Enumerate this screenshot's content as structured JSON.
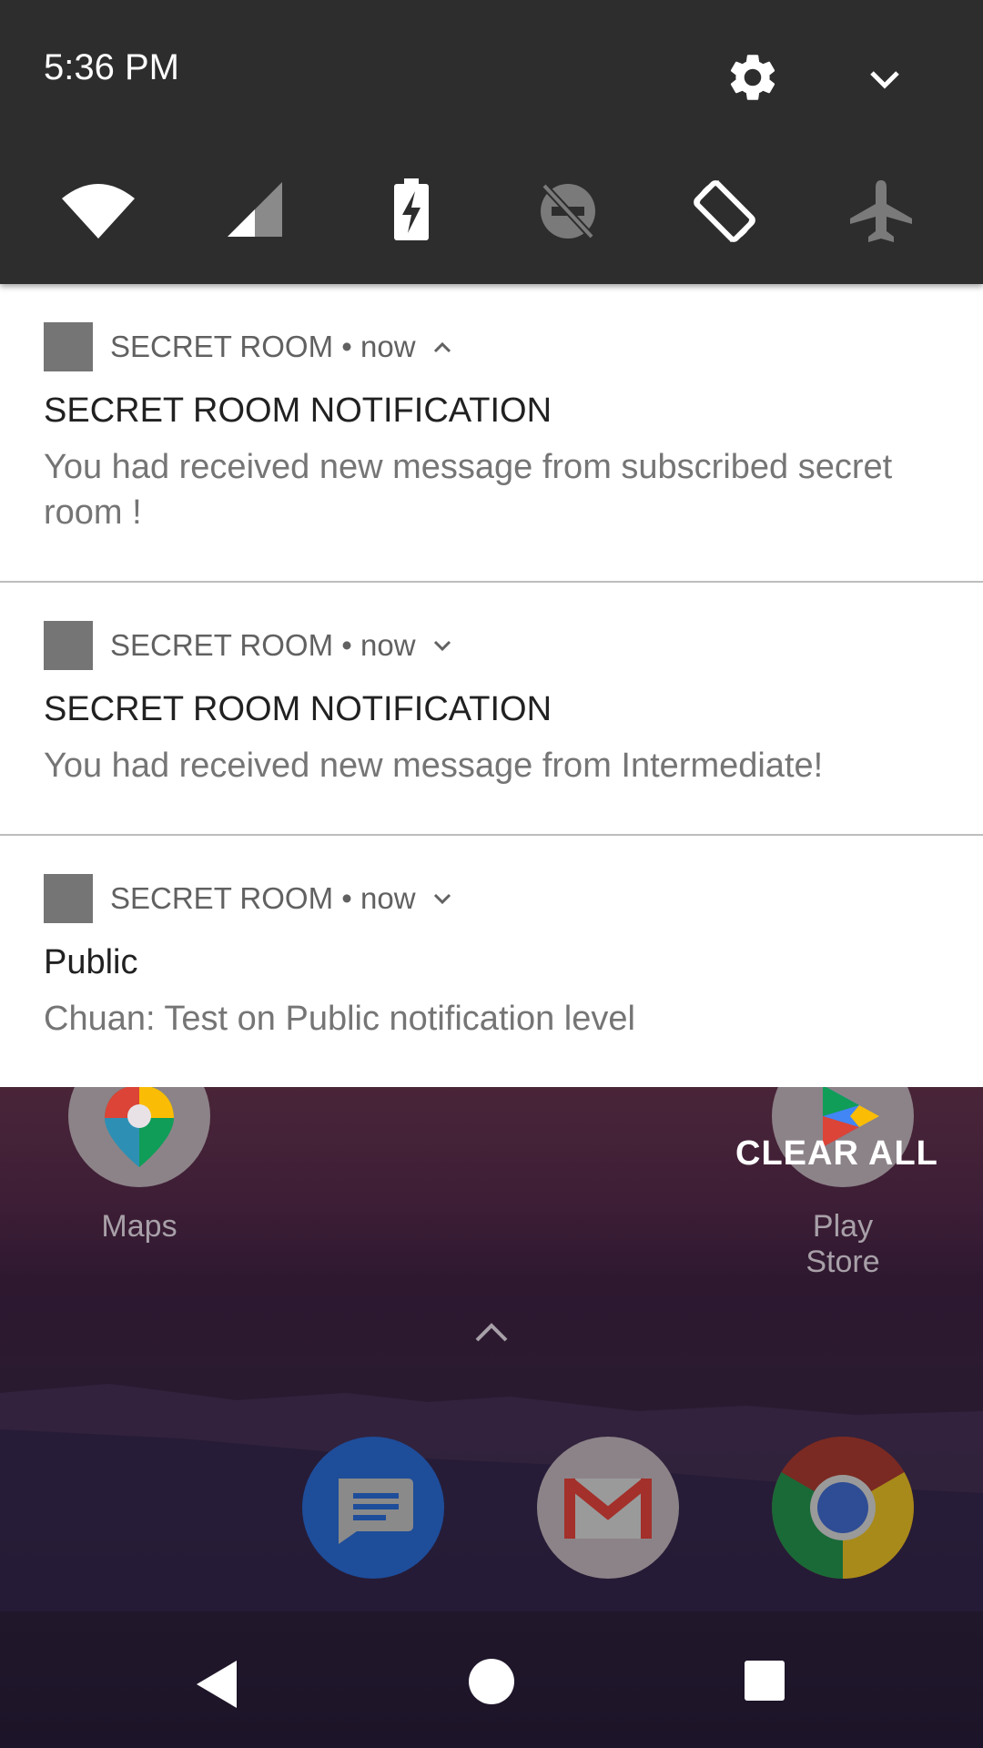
{
  "status": {
    "time": "5:36 PM",
    "settings_icon": "gear-icon",
    "expand_icon": "chevron-down-icon"
  },
  "quick_settings": [
    {
      "name": "wifi",
      "icon": "wifi-icon"
    },
    {
      "name": "cellular",
      "icon": "cellular-signal-icon"
    },
    {
      "name": "battery-saver",
      "icon": "battery-charging-icon"
    },
    {
      "name": "do-not-disturb",
      "icon": "dnd-off-icon"
    },
    {
      "name": "auto-rotate",
      "icon": "auto-rotate-icon"
    },
    {
      "name": "airplane-mode",
      "icon": "airplane-icon"
    }
  ],
  "notifications": [
    {
      "app": "SECRET ROOM",
      "time": "now",
      "expanded": true,
      "title": "SECRET ROOM NOTIFICATION",
      "body": "You had received new message from subscribed secret room !"
    },
    {
      "app": "SECRET ROOM",
      "time": "now",
      "expanded": false,
      "title": "SECRET ROOM NOTIFICATION",
      "body": "You had received new message from Intermediate!"
    },
    {
      "app": "SECRET ROOM",
      "time": "now",
      "expanded": false,
      "title": "Public",
      "body": "Chuan: Test on Public notification level"
    }
  ],
  "separator": " • ",
  "clear_all": "CLEAR ALL",
  "home": {
    "apps": [
      {
        "label": "Maps",
        "icon": "maps-icon"
      },
      {
        "label": "Play Store",
        "icon": "play-store-icon"
      }
    ],
    "dock": [
      {
        "icon": "messages-icon"
      },
      {
        "icon": "gmail-icon"
      },
      {
        "icon": "chrome-icon"
      }
    ]
  },
  "navbar": {
    "back_icon": "back-icon",
    "home_icon": "home-icon",
    "recents_icon": "recents-icon"
  },
  "colors": {
    "shade": "#2d2d2d",
    "notification_bg": "#ffffff",
    "app_icon_placeholder": "#757575"
  }
}
